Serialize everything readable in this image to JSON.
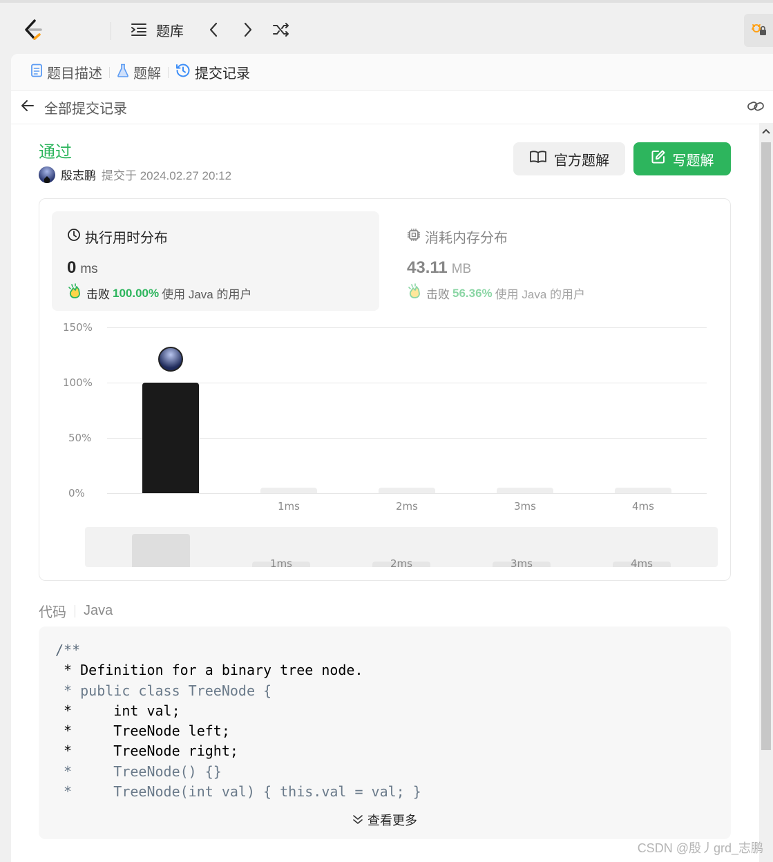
{
  "topbar": {
    "problem_list_label": "题库"
  },
  "tabs": [
    {
      "label": "题目描述"
    },
    {
      "label": "题解"
    },
    {
      "label": "提交记录"
    }
  ],
  "subheader": {
    "title": "全部提交记录"
  },
  "submission": {
    "status": "通过",
    "user": "殷志鹏",
    "submitted_text": "提交于 2024.02.27 20:12"
  },
  "buttons": {
    "official_solution": "官方题解",
    "write_solution": "写题解"
  },
  "runtime": {
    "title": "执行用时分布",
    "value": "0",
    "unit": "ms",
    "beat_label": "击败",
    "beat_pct": "100.00%",
    "beat_suffix": "使用 Java 的用户"
  },
  "memory": {
    "title": "消耗内存分布",
    "value": "43.11",
    "unit": "MB",
    "beat_label": "击败",
    "beat_pct": "56.36%",
    "beat_suffix": "使用 Java 的用户"
  },
  "chart_data": {
    "type": "bar",
    "title": "",
    "xlabel": "",
    "ylabel": "",
    "ylim": [
      0,
      150
    ],
    "yticks": [
      "150%",
      "100%",
      "50%",
      "0%"
    ],
    "categories": [
      "",
      "1ms",
      "2ms",
      "3ms",
      "4ms"
    ],
    "values": [
      100,
      0,
      0,
      0,
      0
    ],
    "overview_ticks": [
      "1ms",
      "2ms",
      "3ms",
      "4ms"
    ],
    "highlight_index": 0,
    "colors": {
      "highlight": "#1a1a1a",
      "other": "#eeeeee"
    }
  },
  "code": {
    "label": "代码",
    "language": "Java",
    "lines": [
      {
        "text": "/**",
        "style": "c-comment"
      },
      {
        "text": " * Definition for a binary tree node.",
        "style": "c-dark"
      },
      {
        "text": " * public class TreeNode {",
        "style": "c-gray"
      },
      {
        "text": " *     int val;",
        "style": "c-dark"
      },
      {
        "text": " *     TreeNode left;",
        "style": "c-dark"
      },
      {
        "text": " *     TreeNode right;",
        "style": "c-dark"
      },
      {
        "text": " *     TreeNode() {}",
        "style": "c-gray"
      },
      {
        "text": " *     TreeNode(int val) { this.val = val; }",
        "style": "c-gray"
      }
    ],
    "more_label": "查看更多"
  },
  "watermark": "CSDN @殷丿grd_志鹏",
  "colors": {
    "accent": "#2db55d",
    "brand_orange": "#ffa116"
  }
}
